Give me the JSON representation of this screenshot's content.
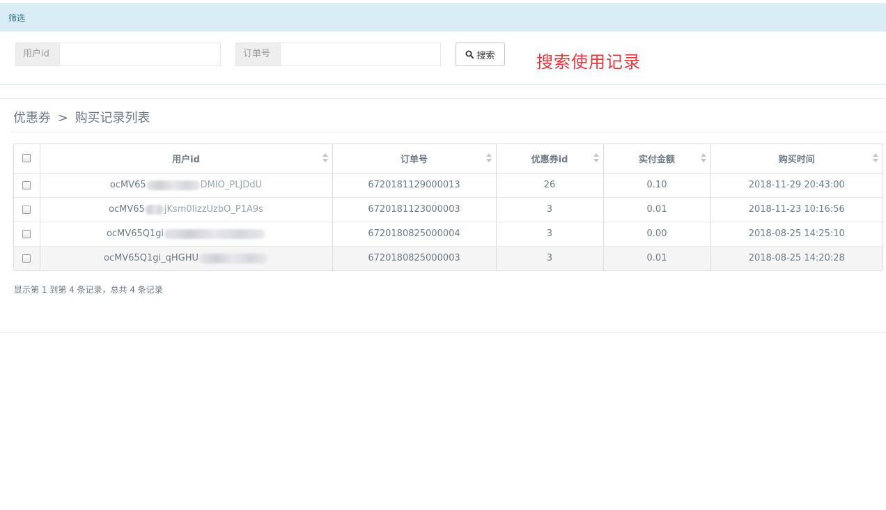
{
  "filter": {
    "title": "筛选",
    "user_id_label": "用户id",
    "user_id_value": "",
    "order_no_label": "订单号",
    "order_no_value": "",
    "search_label": "搜索",
    "annotation": "搜索使用记录"
  },
  "breadcrumb": {
    "parent": "优惠券",
    "separator": ">",
    "current": "购买记录列表"
  },
  "table": {
    "columns": [
      "用户id",
      "订单号",
      "优惠券id",
      "实付金额",
      "购买时间"
    ],
    "rows": [
      {
        "user_id_prefix": "ocMV65",
        "user_id_suffix": "DMIO_PLJDdU",
        "order_no": "6720181129000013",
        "coupon_id": "26",
        "amount": "0.10",
        "time": "2018-11-29 20:43:00"
      },
      {
        "user_id_prefix": "ocMV65",
        "user_id_suffix": "jKsm0lizzUzbO_P1A9s",
        "order_no": "6720181123000003",
        "coupon_id": "3",
        "amount": "0.01",
        "time": "2018-11-23 10:16:56"
      },
      {
        "user_id_prefix": "ocMV65Q1gi",
        "user_id_suffix": "",
        "order_no": "6720180825000004",
        "coupon_id": "3",
        "amount": "0.00",
        "time": "2018-08-25 14:25:10"
      },
      {
        "user_id_prefix": "ocMV65Q1gi_qHGHU",
        "user_id_suffix": "",
        "order_no": "6720180825000003",
        "coupon_id": "3",
        "amount": "0.01",
        "time": "2018-08-25 14:20:28"
      }
    ]
  },
  "pagination": {
    "info": "显示第 1 到第 4 条记录，总共 4 条记录"
  }
}
